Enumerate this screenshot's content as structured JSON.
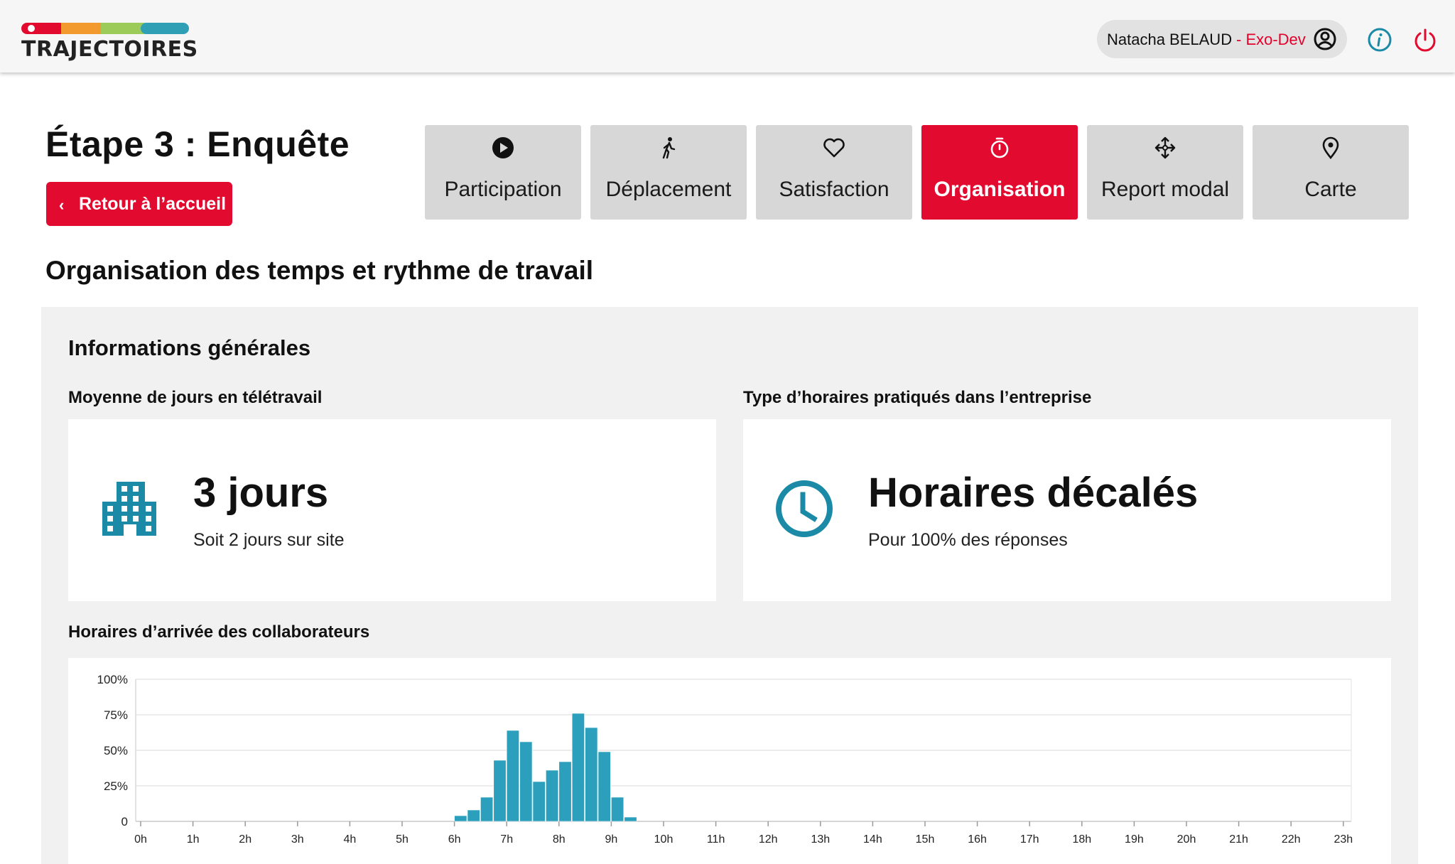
{
  "header": {
    "logo_text": "TRAJECTOIRES",
    "logo_colors": [
      "#e30a2f",
      "#f29a2e",
      "#9ccb5a",
      "#2f9fb5"
    ],
    "user_name": "Natacha BELAUD",
    "user_org": "- Exo-Dev",
    "icons": {
      "user": "user-circle-icon",
      "info": "info-icon",
      "power": "power-icon"
    }
  },
  "page": {
    "title": "Étape 3 : Enquête",
    "back_label": "Retour à l’accueil",
    "section_title": "Organisation des temps et rythme de travail"
  },
  "tabs": [
    {
      "label": "Participation",
      "icon": "play-icon",
      "active": false
    },
    {
      "label": "Déplacement",
      "icon": "walking-icon",
      "active": false
    },
    {
      "label": "Satisfaction",
      "icon": "heart-icon",
      "active": false
    },
    {
      "label": "Organisation",
      "icon": "stopwatch-icon",
      "active": true
    },
    {
      "label": "Report modal",
      "icon": "arrows-split-icon",
      "active": false
    },
    {
      "label": "Carte",
      "icon": "map-pin-icon",
      "active": false
    }
  ],
  "info": {
    "heading": "Informations générales",
    "telework": {
      "label": "Moyenne de jours en télétravail",
      "value": "3 jours",
      "sub": "Soit 2 jours sur site",
      "icon": "building-icon"
    },
    "schedule": {
      "label": "Type d’horaires pratiqués dans l’entreprise",
      "value": "Horaires décalés",
      "sub": "Pour 100% des réponses",
      "icon": "clock-icon"
    }
  },
  "colors": {
    "accent": "#e30a2f",
    "teal": "#1a8aa6",
    "bar": "#2b9fbb"
  },
  "chart": {
    "label": "Horaires d’arrivée des collaborateurs"
  },
  "chart_data": {
    "type": "bar",
    "title": "Horaires d’arrivée des collaborateurs",
    "x_ticks": [
      "0h",
      "1h",
      "2h",
      "3h",
      "4h",
      "5h",
      "6h",
      "7h",
      "8h",
      "9h",
      "10h",
      "11h",
      "12h",
      "13h",
      "14h",
      "15h",
      "16h",
      "17h",
      "18h",
      "19h",
      "20h",
      "21h",
      "22h",
      "23h"
    ],
    "y_ticks": [
      "100%",
      "75%",
      "50%",
      "25%",
      "0"
    ],
    "ylim": [
      0,
      100
    ],
    "bin_minutes": 15,
    "x_start_hours": 6.0,
    "values": [
      4,
      8,
      17,
      43,
      64,
      56,
      28,
      36,
      42,
      76,
      66,
      49,
      17,
      3
    ],
    "grid": true,
    "legend": "none"
  }
}
